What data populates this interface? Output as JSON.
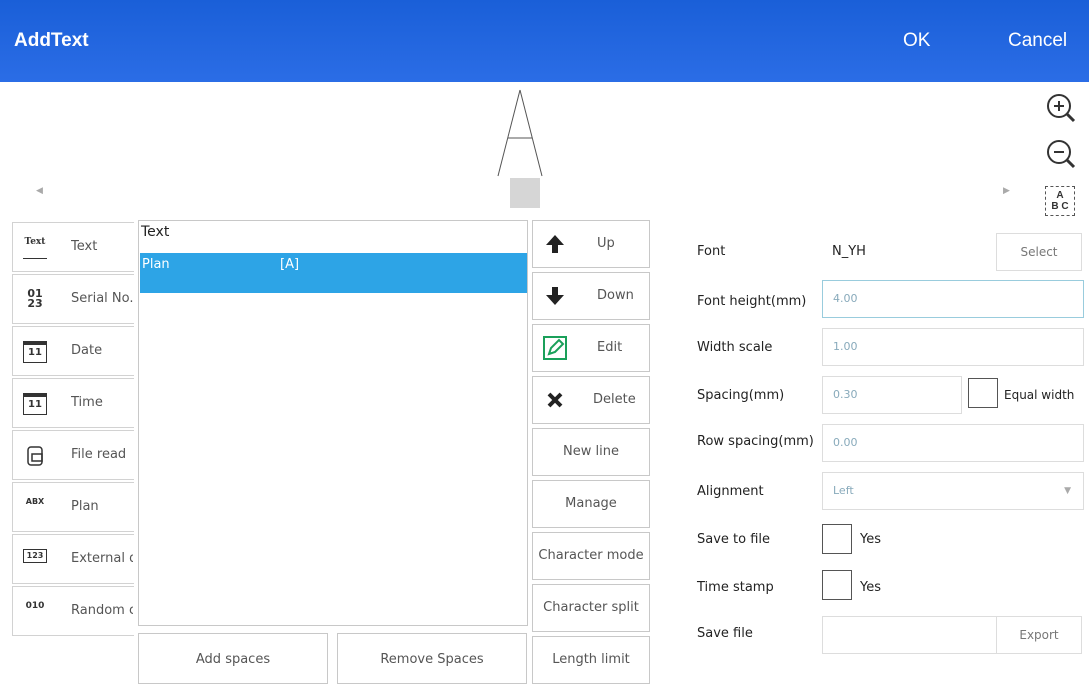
{
  "title": "AddText",
  "header": {
    "ok_label": "OK",
    "cancel_label": "Cancel"
  },
  "preview": {
    "glyph": "A",
    "abc_label_top": "A",
    "abc_label_bottom": "B C"
  },
  "tools": [
    {
      "icon": "Text",
      "label": "Text"
    },
    {
      "icon": "01 23",
      "label": "Serial No."
    },
    {
      "icon": "11",
      "label": "Date"
    },
    {
      "icon": "11",
      "label": "Time"
    },
    {
      "icon": "",
      "label": "File read"
    },
    {
      "icon": "ABX",
      "label": "Plan"
    },
    {
      "icon": "123",
      "label": "External d"
    },
    {
      "icon": "010",
      "label": "Random c"
    }
  ],
  "list": {
    "header": "Text",
    "rows": [
      {
        "name": "Plan",
        "value": "[A]"
      }
    ]
  },
  "bottom_buttons": {
    "add_spaces": "Add spaces",
    "remove_spaces": "Remove Spaces"
  },
  "side_buttons": {
    "up": "Up",
    "down": "Down",
    "edit": "Edit",
    "delete": "Delete",
    "new_line": "New line",
    "manage": "Manage",
    "character_mode": "Character mode",
    "character_split": "Character split",
    "length_limit": "Length limit"
  },
  "props": {
    "font_label": "Font",
    "font_value": "N_YH",
    "select_label": "Select",
    "font_height_label": "Font height(mm)",
    "font_height_value": "4.00",
    "width_scale_label": "Width scale",
    "width_scale_value": "1.00",
    "spacing_label": "Spacing(mm)",
    "spacing_value": "0.30",
    "equal_width_label": "Equal width",
    "row_spacing_label": "Row spacing(mm)",
    "row_spacing_value": "0.00",
    "alignment_label": "Alignment",
    "alignment_value": "Left",
    "save_to_file_label": "Save to file",
    "save_to_file_yes": "Yes",
    "time_stamp_label": "Time stamp",
    "time_stamp_yes": "Yes",
    "save_file_label": "Save file",
    "save_file_value": "",
    "export_label": "Export"
  }
}
